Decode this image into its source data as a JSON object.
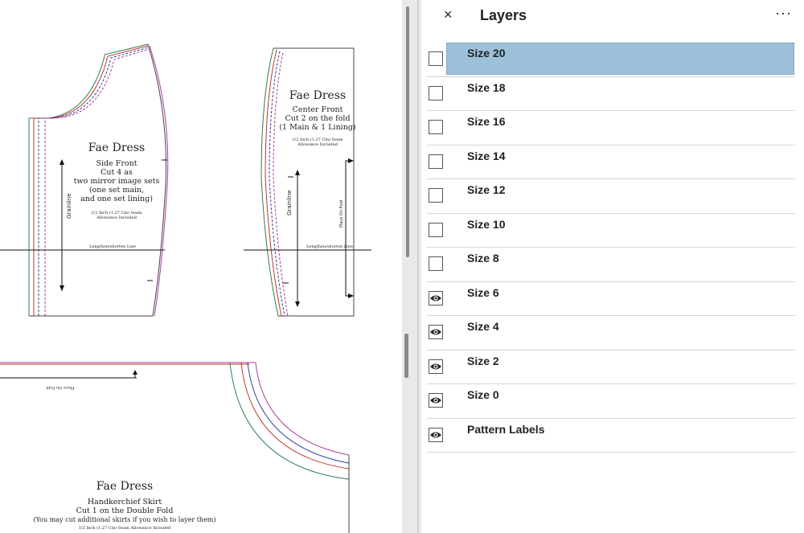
{
  "pattern": {
    "side_front": {
      "title": "Fae Dress",
      "lines": [
        "Side Front",
        "Cut 4 as",
        "two mirror image sets",
        "(one set main,",
        "and one set lining)"
      ],
      "seam": [
        "1/2 Inch (1.27 Cm) Seam",
        "Allowance Included"
      ],
      "grainline": "Grainline",
      "lengthen": "Lengthen/shorten Line"
    },
    "center_front": {
      "title": "Fae Dress",
      "lines": [
        "Center Front",
        "Cut 2 on the fold",
        "(1 Main & 1 Lining)"
      ],
      "seam": [
        "1/2 Inch (1.27 Cm) Seam",
        "Allowance Included"
      ],
      "grainline": "Grainline",
      "fold": "Place On Fold",
      "lengthen": "Lengthen/shorten Line"
    },
    "skirt": {
      "title": "Fae Dress",
      "lines": [
        "Handkerchief Skirt",
        "Cut 1 on the Double Fold",
        "(You may cut additional skirts if you wish to layer them)"
      ],
      "seam": "1/2 Inch (1.27 Cm) Seam Allowance Included",
      "fold": "Place On Fold"
    }
  },
  "panel": {
    "title": "Layers",
    "close_icon": "×",
    "more_icon": "···",
    "layers": [
      {
        "name": "Size 20",
        "visible": false,
        "selected": true
      },
      {
        "name": "Size 18",
        "visible": false
      },
      {
        "name": "Size 16",
        "visible": false
      },
      {
        "name": "Size 14",
        "visible": false
      },
      {
        "name": "Size 12",
        "visible": false
      },
      {
        "name": "Size 10",
        "visible": false
      },
      {
        "name": "Size 8",
        "visible": false
      },
      {
        "name": "Size 6",
        "visible": true
      },
      {
        "name": "Size 4",
        "visible": true
      },
      {
        "name": "Size 2",
        "visible": true
      },
      {
        "name": "Size 0",
        "visible": true
      },
      {
        "name": "Pattern Labels",
        "visible": true
      }
    ]
  }
}
